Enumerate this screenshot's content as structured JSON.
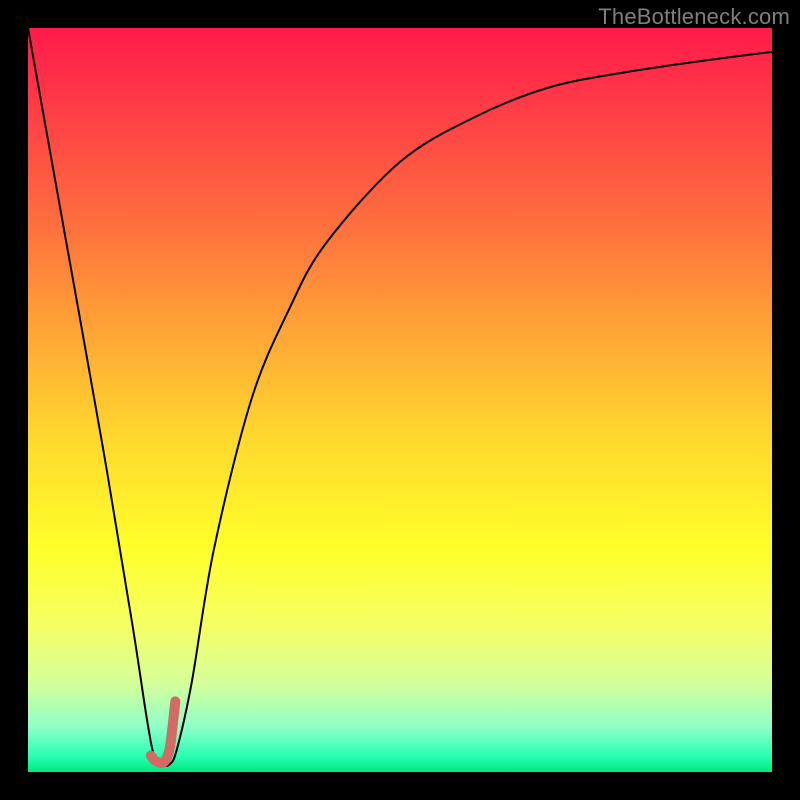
{
  "watermark": {
    "text": "TheBottleneck.com"
  },
  "chart_data": {
    "type": "line",
    "title": "",
    "xlabel": "",
    "ylabel": "",
    "xlim": [
      0,
      100
    ],
    "ylim": [
      0,
      100
    ],
    "grid": false,
    "series": [
      {
        "name": "bottleneck-curve",
        "color": "#000000",
        "linewidth": 2,
        "x": [
          0,
          5,
          10,
          14,
          16,
          17,
          18,
          19,
          20,
          22,
          25,
          30,
          35,
          40,
          50,
          60,
          70,
          80,
          90,
          100
        ],
        "y": [
          100,
          72,
          44,
          20,
          7,
          2,
          1,
          1,
          3,
          12,
          30,
          50,
          62,
          71,
          82,
          88,
          92,
          94,
          95.5,
          96.8
        ]
      },
      {
        "name": "highlight-segment",
        "color": "#d26b64",
        "linewidth": 10,
        "x": [
          16.5,
          17.0,
          17.5,
          18.0,
          18.5,
          19.0,
          19.3,
          19.8
        ],
        "y": [
          2.2,
          1.6,
          1.3,
          1.2,
          1.6,
          3.0,
          5.0,
          9.5
        ]
      }
    ],
    "background_gradient": {
      "direction": "vertical",
      "stops": [
        {
          "pos": 0,
          "color": "#ff1a4a"
        },
        {
          "pos": 25,
          "color": "#ff6a3f"
        },
        {
          "pos": 55,
          "color": "#ffd82e"
        },
        {
          "pos": 80,
          "color": "#f6ff63"
        },
        {
          "pos": 100,
          "color": "#00e87e"
        }
      ]
    }
  }
}
